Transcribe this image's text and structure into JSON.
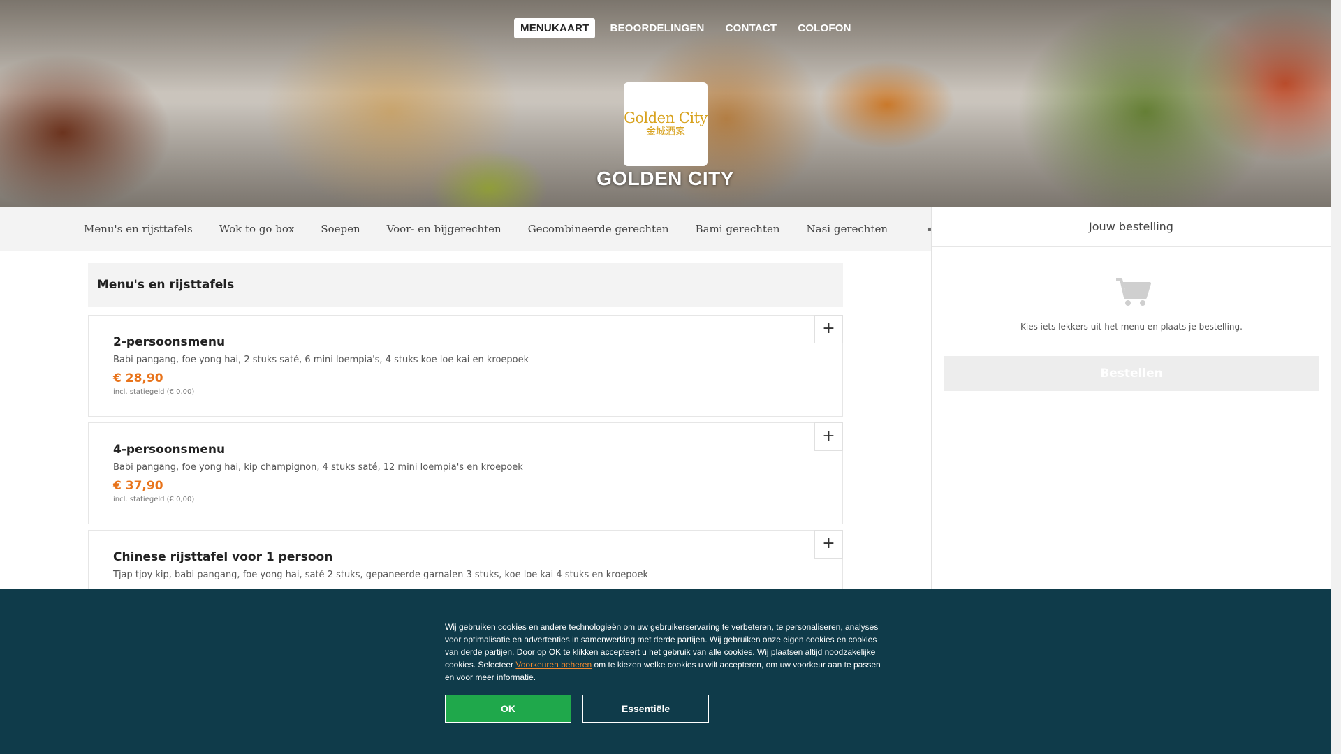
{
  "nav": {
    "items": [
      {
        "label": "MENUKAART",
        "active": true
      },
      {
        "label": "BEOORDELINGEN",
        "active": false
      },
      {
        "label": "CONTACT",
        "active": false
      },
      {
        "label": "COLOFON",
        "active": false
      }
    ]
  },
  "restaurant": {
    "logo_text_en": "Golden City",
    "logo_text_cn": "金城酒家",
    "name": "GOLDEN CITY"
  },
  "categories": {
    "items": [
      "Menu's en rijsttafels",
      "Wok to go box",
      "Soepen",
      "Voor- en bijgerechten",
      "Gecombineerde gerechten",
      "Bami gerechten",
      "Nasi gerechten"
    ],
    "more_icon": "dot-more-icon"
  },
  "menu": {
    "section_title": "Menu's en rijsttafels",
    "add_label": "+",
    "items": [
      {
        "name": "2-persoonsmenu",
        "description": "Babi pangang, foe yong hai, 2 stuks saté, 6 mini loempia's, 4 stuks koe loe kai en kroepoek",
        "price": "€ 28,90",
        "deposit": "incl. statiegeld (€ 0,00)"
      },
      {
        "name": "4-persoonsmenu",
        "description": "Babi pangang, foe yong hai, kip champignon, 4 stuks saté, 12 mini loempia's en kroepoek",
        "price": "€ 37,90",
        "deposit": "incl. statiegeld (€ 0,00)"
      },
      {
        "name": "Chinese rijsttafel voor 1 persoon",
        "description": "Tjap tjoy kip, babi pangang, foe yong hai, saté 2 stuks, gepaneerde garnalen 3 stuks, koe loe kai 4 stuks en kroepoek",
        "price": "",
        "deposit": ""
      }
    ]
  },
  "basket": {
    "title": "Jouw bestelling",
    "icon": "shopping-cart-icon",
    "empty_text": "Kies iets lekkers uit het menu en plaats je bestelling.",
    "order_button": "Bestellen"
  },
  "cookie": {
    "text_before": "Wij gebruiken cookies en andere technologieën om uw gebruikerservaring te verbeteren, te personaliseren, analyses voor optimalisatie en advertenties in samenwerking met derde partijen. Wij gebruiken onze eigen cookies en cookies van derde partijen. Door op OK te klikken accepteert u het gebruik van alle cookies. Wij plaatsen altijd noodzakelijke cookies. Selecteer ",
    "link_text": "Voorkeuren beheren",
    "text_after": " om te kiezen welke cookies u wilt accepteren, om uw voorkeur aan te passen en voor meer informatie.",
    "ok_label": "OK",
    "essential_label": "Essentiële"
  },
  "colors": {
    "accent": "#e8731a",
    "cookie_bg": "#0f3b4a",
    "ok_green": "#1fa84b",
    "logo_gold": "#d8a21e"
  }
}
